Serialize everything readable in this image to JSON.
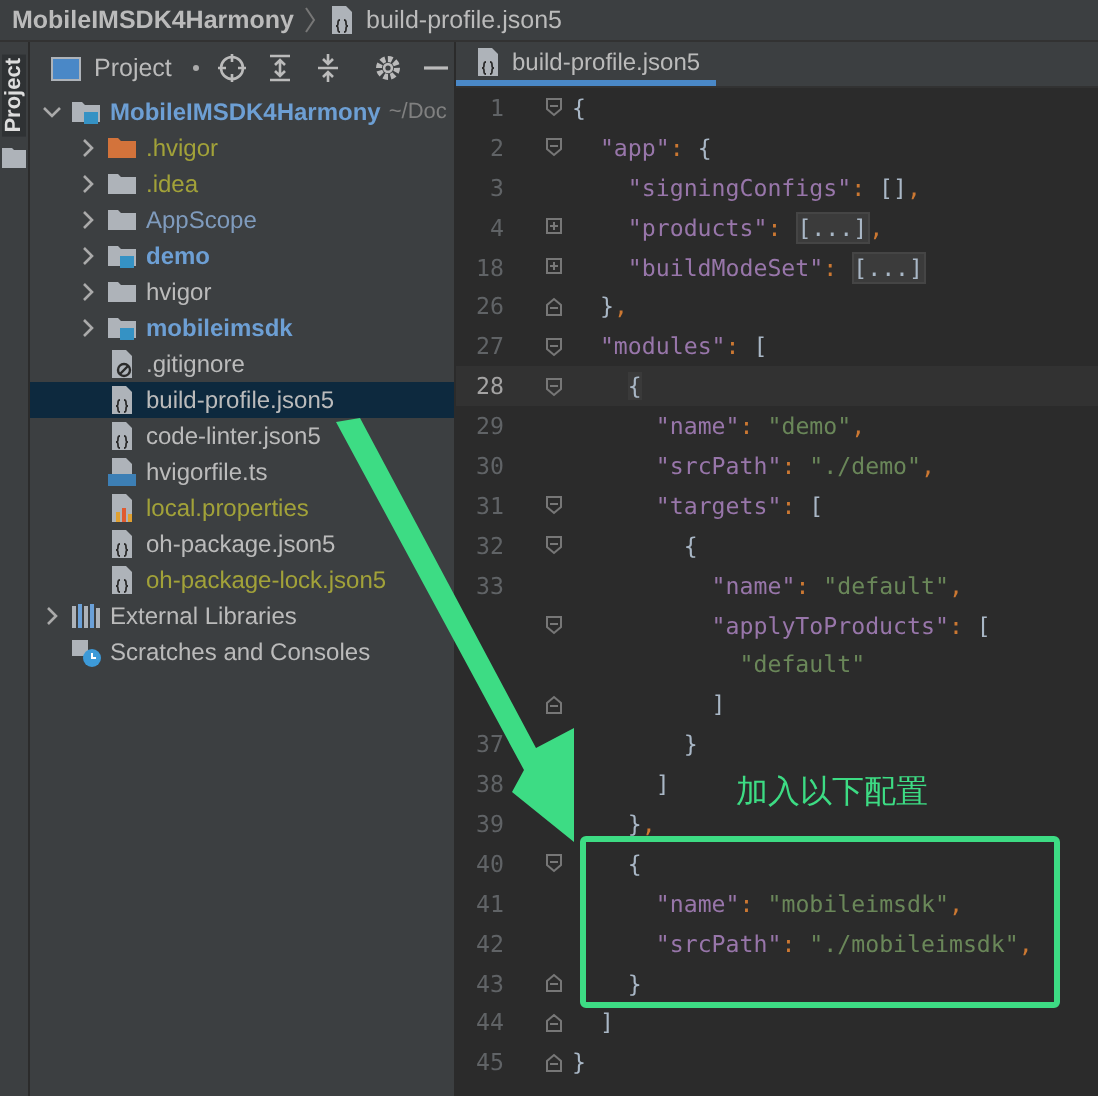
{
  "breadcrumb": [
    {
      "label": "MobileIMSDK4Harmony",
      "kind": "project"
    },
    {
      "label": "build-profile.json5",
      "kind": "file"
    }
  ],
  "tool_stripe": {
    "tab": "Project",
    "selected": true
  },
  "project_panel": {
    "title": "Project",
    "tree": [
      {
        "label": "MobileIMSDK4Harmony",
        "hint": "~/Doc",
        "kind": "module",
        "ignored": false,
        "added": false,
        "expanded": true,
        "selected": false,
        "children": [
          {
            "label": ".hvigor",
            "kind": "excluded",
            "ignored": true,
            "added": false,
            "expanded": false,
            "selected": false
          },
          {
            "label": ".idea",
            "kind": "folder",
            "ignored": true,
            "added": false,
            "expanded": false,
            "selected": false
          },
          {
            "label": "AppScope",
            "kind": "folder",
            "ignored": false,
            "added": true,
            "expanded": false,
            "selected": false
          },
          {
            "label": "demo",
            "kind": "module",
            "ignored": false,
            "added": false,
            "expanded": false,
            "selected": false
          },
          {
            "label": "hvigor",
            "kind": "folder",
            "ignored": false,
            "added": false,
            "expanded": false,
            "selected": false
          },
          {
            "label": "mobileimsdk",
            "kind": "module",
            "ignored": false,
            "added": false,
            "expanded": false,
            "selected": false
          },
          {
            "label": ".gitignore",
            "kind": "ignore",
            "ignored": false,
            "added": false,
            "selected": false
          },
          {
            "label": "build-profile.json5",
            "kind": "json",
            "ignored": false,
            "added": false,
            "selected": true
          },
          {
            "label": "code-linter.json5",
            "kind": "json",
            "ignored": false,
            "added": false,
            "selected": false
          },
          {
            "label": "hvigorfile.ts",
            "kind": "ts",
            "ignored": false,
            "added": false,
            "selected": false
          },
          {
            "label": "local.properties",
            "kind": "properties",
            "ignored": true,
            "added": false,
            "selected": false
          },
          {
            "label": "oh-package.json5",
            "kind": "json",
            "ignored": false,
            "added": false,
            "selected": false
          },
          {
            "label": "oh-package-lock.json5",
            "kind": "json",
            "ignored": true,
            "added": false,
            "selected": false
          }
        ]
      },
      {
        "label": "External Libraries",
        "kind": "library",
        "ignored": false,
        "added": false,
        "expanded": false,
        "selected": false
      },
      {
        "label": "Scratches and Consoles",
        "kind": "scratches",
        "ignored": false,
        "added": false,
        "selected": false
      }
    ]
  },
  "editor": {
    "tabs": [
      {
        "label": "build-profile.json5",
        "selected": true
      }
    ],
    "lines": [
      {
        "number": "1",
        "text": "{",
        "fold_start": true,
        "fold_end": false,
        "folded": false,
        "current": false
      },
      {
        "number": "2",
        "text": "  \"app\": {",
        "fold_start": true,
        "fold_end": false,
        "folded": false,
        "current": false
      },
      {
        "number": "3",
        "text": "    \"signingConfigs\": [],",
        "fold_start": false,
        "fold_end": false,
        "folded": false,
        "current": false
      },
      {
        "number": "4",
        "text": "    \"products\": [...],",
        "fold_start": false,
        "fold_end": false,
        "folded": true,
        "current": false
      },
      {
        "number": "18",
        "text": "    \"buildModeSet\": [...]",
        "fold_start": false,
        "fold_end": false,
        "folded": true,
        "current": false
      },
      {
        "number": "26",
        "text": "  },",
        "fold_start": false,
        "fold_end": true,
        "folded": false,
        "current": false
      },
      {
        "number": "27",
        "text": "  \"modules\": [",
        "fold_start": true,
        "fold_end": false,
        "folded": false,
        "current": false
      },
      {
        "number": "28",
        "text": "    {",
        "fold_start": true,
        "fold_end": false,
        "folded": false,
        "current": true
      },
      {
        "number": "29",
        "text": "      \"name\": \"demo\",",
        "fold_start": false,
        "fold_end": false,
        "folded": false,
        "current": false
      },
      {
        "number": "30",
        "text": "      \"srcPath\": \"./demo\",",
        "fold_start": false,
        "fold_end": false,
        "folded": false,
        "current": false
      },
      {
        "number": "31",
        "text": "      \"targets\": [",
        "fold_start": true,
        "fold_end": false,
        "folded": false,
        "current": false
      },
      {
        "number": "32",
        "text": "        {",
        "fold_start": true,
        "fold_end": false,
        "folded": false,
        "current": false
      },
      {
        "number": "33",
        "text": "          \"name\": \"default\",",
        "fold_start": false,
        "fold_end": false,
        "folded": false,
        "current": false
      },
      {
        "text": "          \"applyToProducts\": [",
        "fold_start": true,
        "fold_end": false,
        "folded": false,
        "current": false
      },
      {
        "text": "            \"default\"",
        "fold_start": false,
        "fold_end": false,
        "folded": false,
        "current": false
      },
      {
        "text": "          ]",
        "fold_start": false,
        "fold_end": true,
        "folded": false,
        "current": false
      },
      {
        "number": "37",
        "text": "        }",
        "fold_start": false,
        "fold_end": false,
        "folded": false,
        "current": false
      },
      {
        "number": "38",
        "text": "      ]",
        "fold_start": false,
        "fold_end": false,
        "folded": false,
        "current": false
      },
      {
        "number": "39",
        "text": "    },",
        "fold_start": false,
        "fold_end": false,
        "folded": false,
        "current": false
      },
      {
        "number": "40",
        "text": "    {",
        "fold_start": true,
        "fold_end": false,
        "folded": false,
        "current": false
      },
      {
        "number": "41",
        "text": "      \"name\": \"mobileimsdk\",",
        "fold_start": false,
        "fold_end": false,
        "folded": false,
        "current": false
      },
      {
        "number": "42",
        "text": "      \"srcPath\": \"./mobileimsdk\",",
        "fold_start": false,
        "fold_end": false,
        "folded": false,
        "current": false
      },
      {
        "number": "43",
        "text": "    }",
        "fold_start": false,
        "fold_end": true,
        "folded": false,
        "current": false
      },
      {
        "number": "44",
        "text": "  ]",
        "fold_start": false,
        "fold_end": true,
        "folded": false,
        "current": false
      },
      {
        "number": "45",
        "text": "}",
        "fold_start": false,
        "fold_end": true,
        "folded": false,
        "current": false
      }
    ]
  },
  "annotation": {
    "label": "加入以下配置"
  }
}
